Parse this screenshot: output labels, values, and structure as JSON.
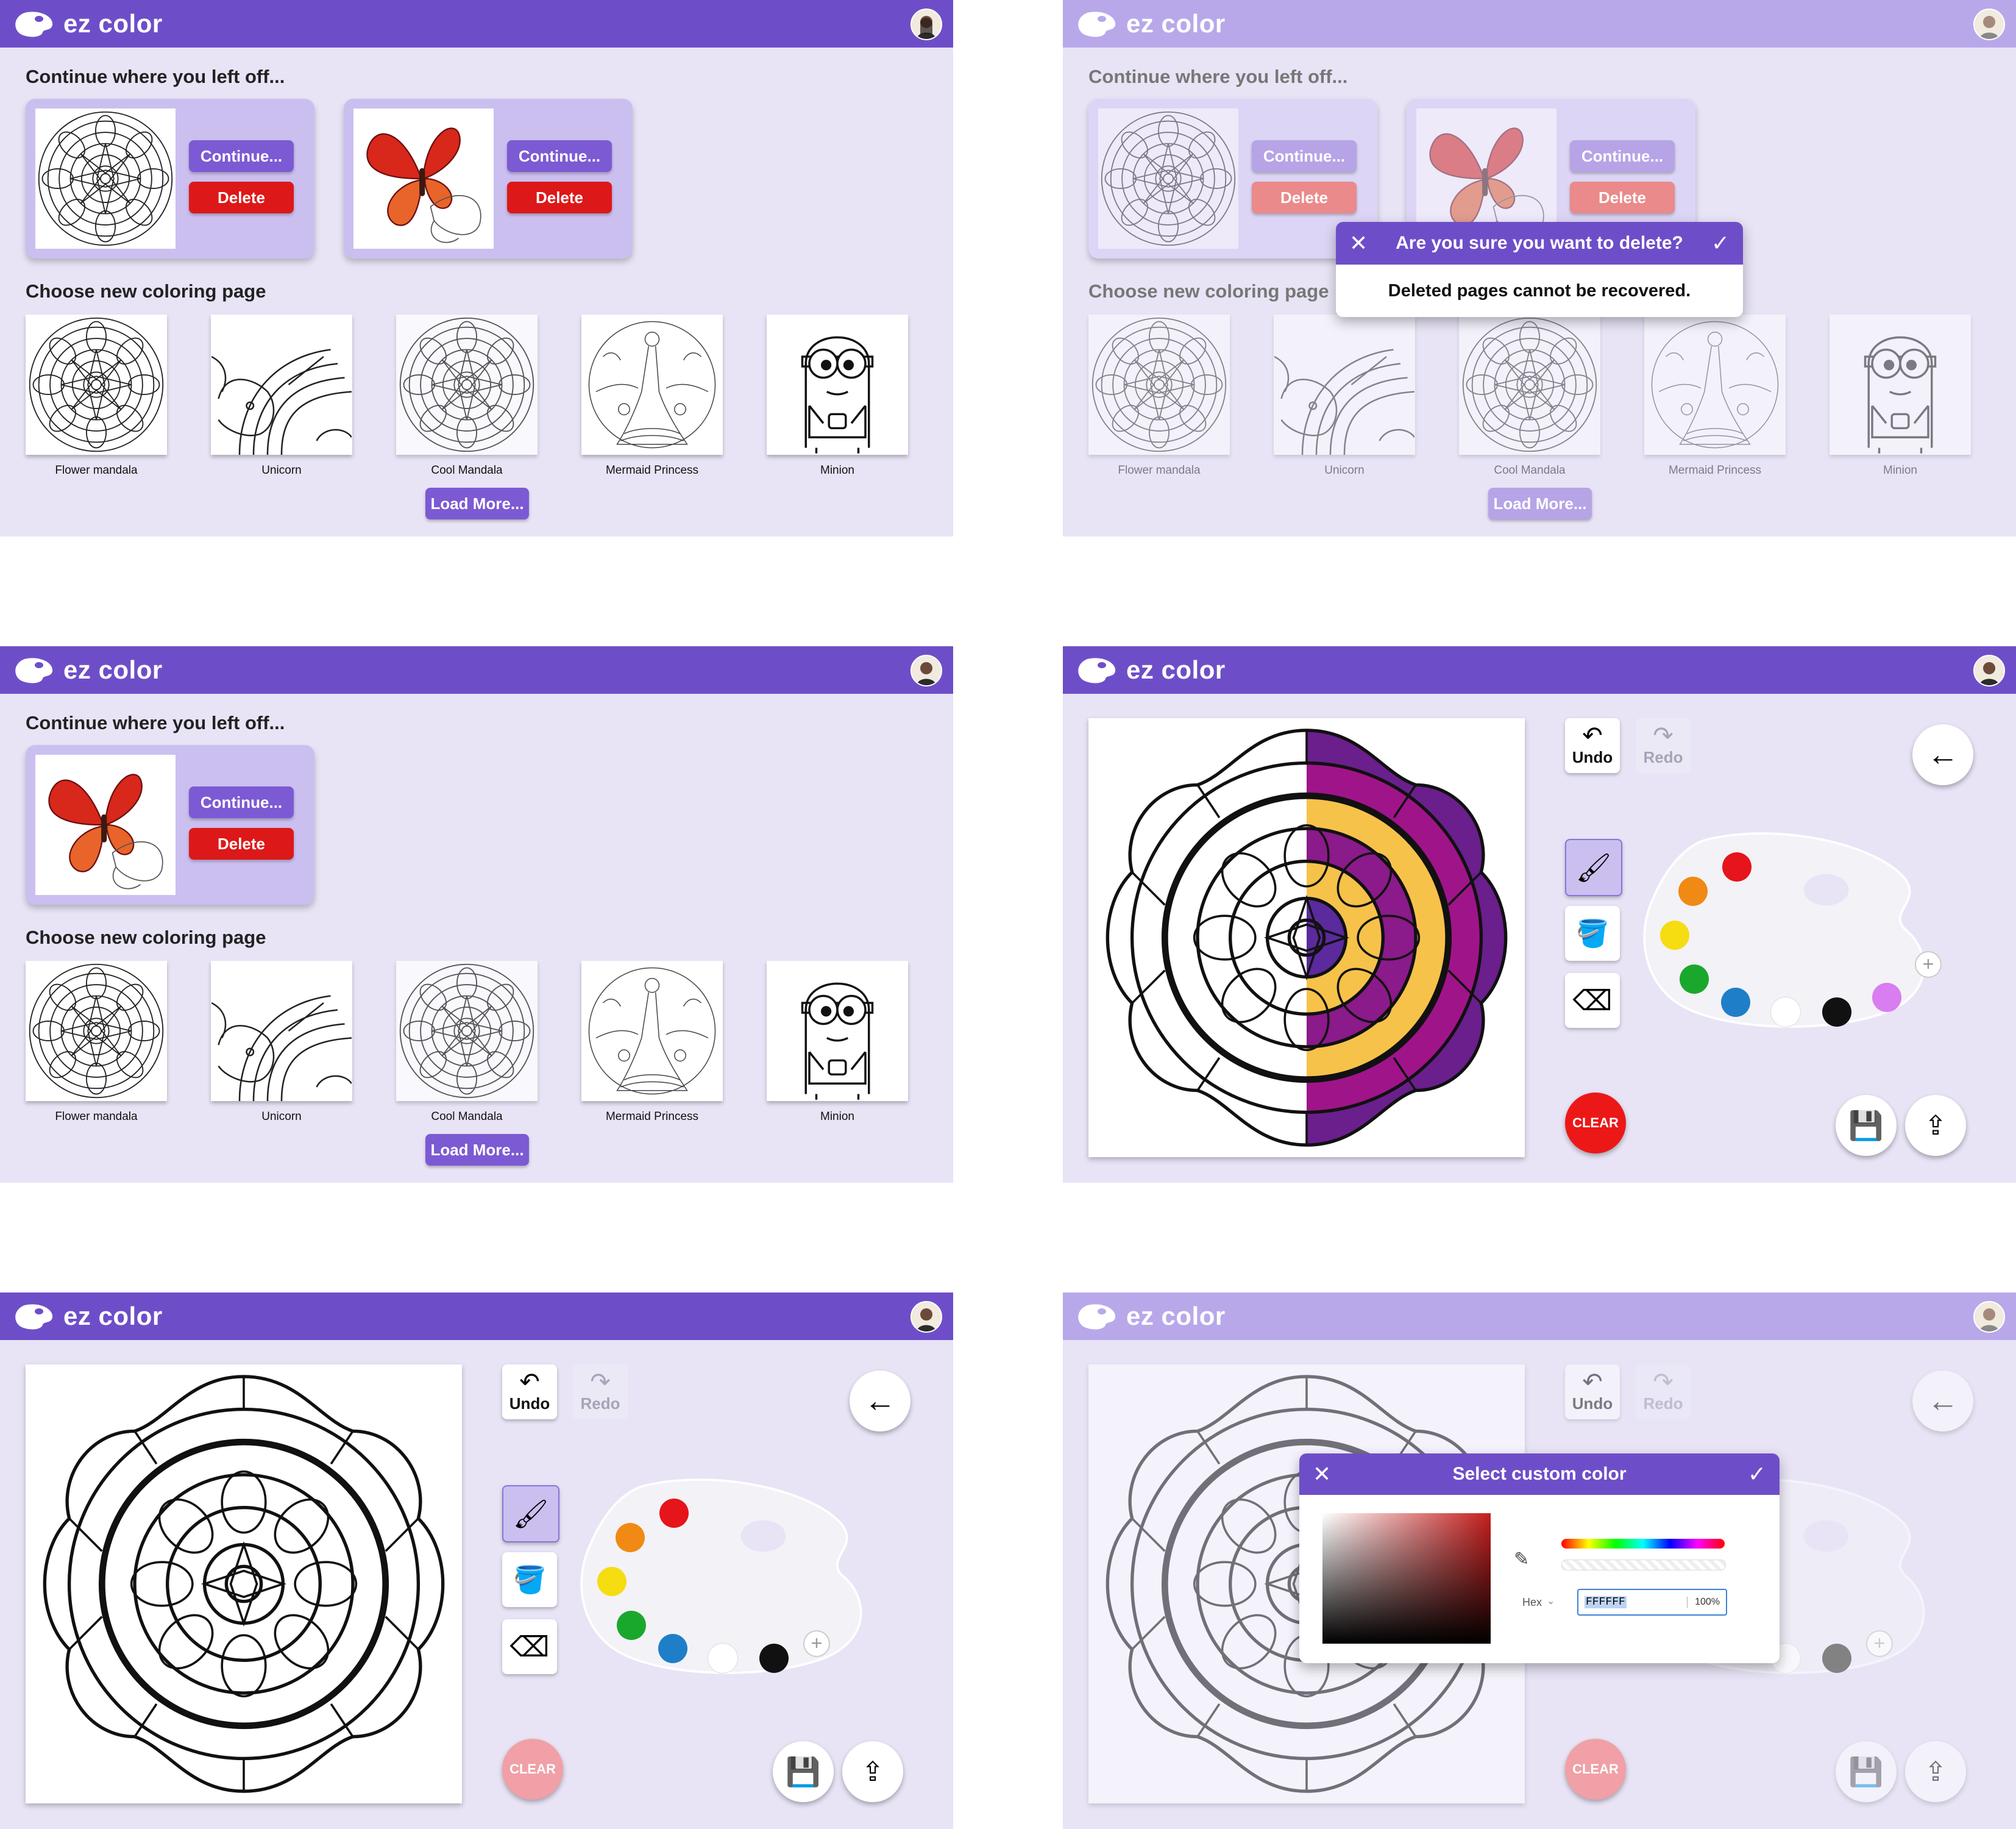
{
  "app": {
    "name": "ez color"
  },
  "home": {
    "continue_heading": "Continue where you left off...",
    "choose_heading": "Choose new coloring page",
    "continue_label": "Continue...",
    "delete_label": "Delete",
    "load_more_label": "Load More...",
    "gallery": [
      {
        "caption": "Flower mandala"
      },
      {
        "caption": "Unicorn"
      },
      {
        "caption": "Cool Mandala"
      },
      {
        "caption": "Mermaid Princess"
      },
      {
        "caption": "Minion"
      }
    ]
  },
  "delete_dialog": {
    "title": "Are you sure you want to delete?",
    "message": "Deleted pages cannot be recovered."
  },
  "editor": {
    "undo_label": "Undo",
    "redo_label": "Redo",
    "clear_label": "CLEAR",
    "palette_colors": [
      "#e6141b",
      "#f08a14",
      "#f5dd12",
      "#1aa82c",
      "#1e7fc8",
      "#ffffff",
      "#111111",
      "#d87ef0"
    ]
  },
  "color_dialog": {
    "title": "Select custom color",
    "hex_label": "Hex",
    "hex_value": "FFFFFF",
    "alpha_value": "100%"
  },
  "colors": {
    "brand": "#6e4ec8",
    "background": "#e8e4f6",
    "danger": "#dd1818"
  }
}
